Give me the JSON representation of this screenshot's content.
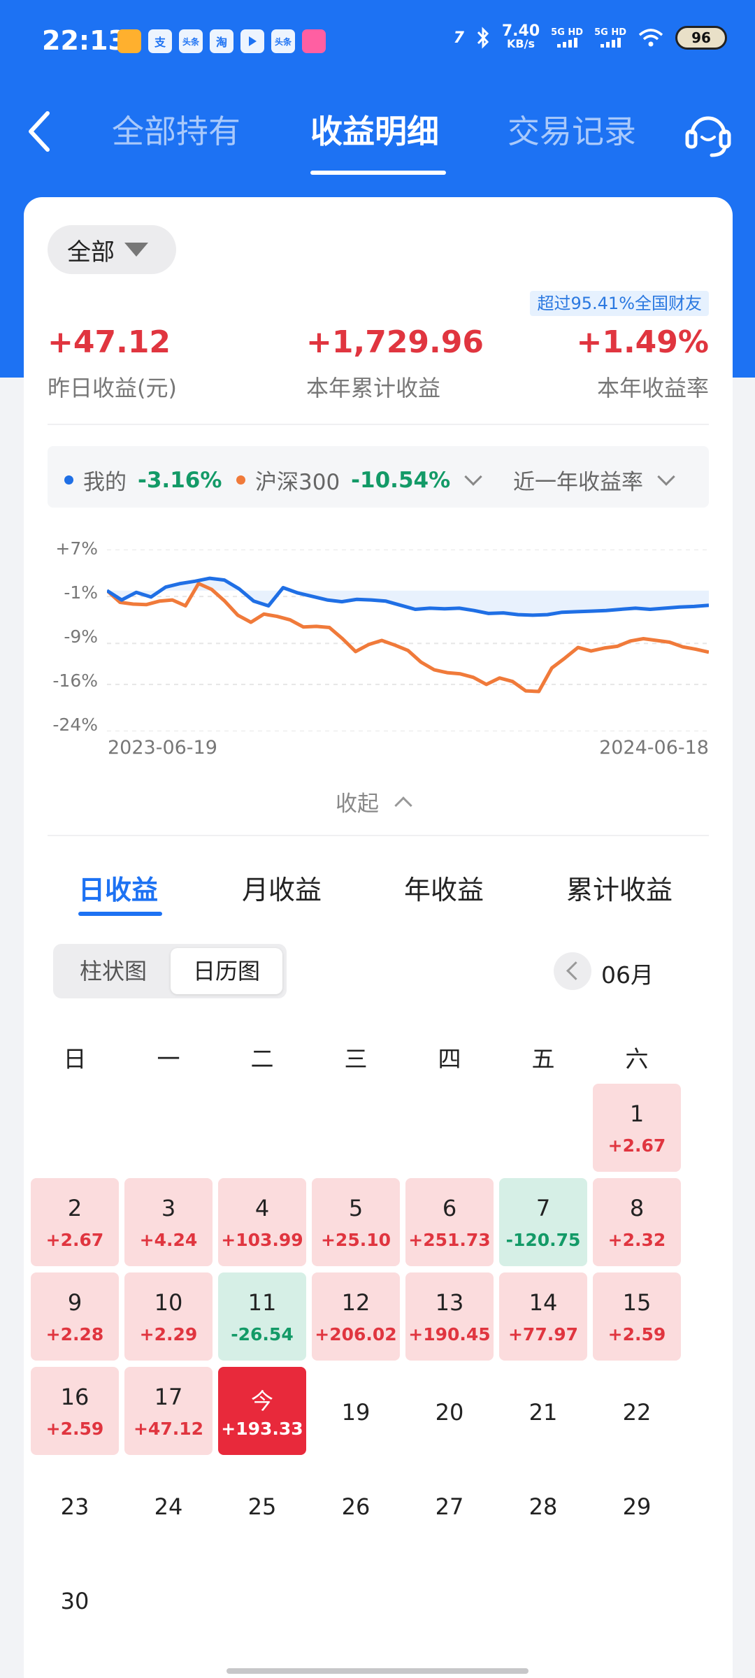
{
  "status_bar": {
    "time": "22:13",
    "apps": [
      {
        "icon": "video-app-icon",
        "label": ""
      },
      {
        "icon": "alipay-icon",
        "label": "支"
      },
      {
        "icon": "toutiao-icon",
        "label": "头条"
      },
      {
        "icon": "taobao-icon",
        "label": "淘"
      },
      {
        "icon": "play-app-icon",
        "label": ""
      },
      {
        "icon": "toutiao-icon",
        "label": "头条"
      },
      {
        "icon": "bilibili-icon",
        "label": ""
      }
    ],
    "carrier_tag": "7",
    "net_speed_value": "7.40",
    "net_speed_unit": "KB/s",
    "signal_1": "5G HD",
    "signal_2": "5G HD",
    "battery": "96"
  },
  "nav": {
    "tabs": [
      "全部持有",
      "收益明细",
      "交易记录"
    ],
    "active_tab": "收益明细"
  },
  "filter": {
    "label": "全部"
  },
  "rank_badge": "超过95.41%全国财友",
  "stats": [
    {
      "value": "+47.12",
      "label": "昨日收益(元)"
    },
    {
      "value": "+1,729.96",
      "label": "本年累计收益"
    },
    {
      "value": "+1.49%",
      "label": "本年收益率"
    }
  ],
  "compare": {
    "mine_label": "我的",
    "mine_value": "-3.16%",
    "index_label": "沪深300",
    "index_value": "-10.54%",
    "period": "近一年收益率"
  },
  "chart_data": {
    "type": "line",
    "yticks": [
      "+7%",
      "-1%",
      "-9%",
      "-16%",
      "-24%"
    ],
    "ylim": [
      -24,
      7
    ],
    "x_start": "2023-06-19",
    "x_end": "2024-06-18",
    "colors": {
      "mine": "#1f6fe5",
      "index": "#f07a3a"
    },
    "series": [
      {
        "name": "我的",
        "values": [
          0,
          -1.6,
          -0.3,
          -1.1,
          0.6,
          1.2,
          1.6,
          2.1,
          1.8,
          0.3,
          -1.8,
          -2.6,
          0.5,
          -0.4,
          -1.0,
          -1.6,
          -1.9,
          -1.5,
          -1.6,
          -1.8,
          -2.5,
          -3.2,
          -3.0,
          -3.1,
          -3.0,
          -3.4,
          -3.9,
          -3.8,
          -4.1,
          -4.2,
          -4.1,
          -3.7,
          -3.6,
          -3.5,
          -3.4,
          -3.2,
          -3.0,
          -3.2,
          -3.0,
          -2.8,
          -2.7,
          -2.5
        ]
      },
      {
        "name": "沪深300",
        "values": [
          0,
          -2.0,
          -2.3,
          -2.4,
          -1.8,
          -1.6,
          -2.6,
          1.2,
          0.2,
          -1.8,
          -4.2,
          -5.4,
          -4.0,
          -4.4,
          -5.0,
          -6.2,
          -6.1,
          -6.3,
          -8.2,
          -10.4,
          -9.2,
          -8.5,
          -9.3,
          -10.2,
          -12.2,
          -13.5,
          -14.0,
          -14.2,
          -14.8,
          -16.0,
          -14.9,
          -15.5,
          -17.1,
          -17.2,
          -13.2,
          -11.5,
          -9.7,
          -10.3,
          -9.8,
          -9.5,
          -8.6,
          -8.2,
          -8.5,
          -8.8,
          -9.6,
          -10.0,
          -10.5
        ]
      }
    ]
  },
  "collapse_label": "收起",
  "period_tabs": [
    "日收益",
    "月收益",
    "年收益",
    "累计收益"
  ],
  "active_period_tab": "日收益",
  "view_toggle": [
    "柱状图",
    "日历图"
  ],
  "active_view": "日历图",
  "month_label": "06月",
  "weekdays": [
    "日",
    "一",
    "二",
    "三",
    "四",
    "五",
    "六"
  ],
  "calendar": [
    {
      "label": "1",
      "value": "+2.67",
      "type": "gain"
    },
    {
      "label": "2",
      "value": "+2.67",
      "type": "gain"
    },
    {
      "label": "3",
      "value": "+4.24",
      "type": "gain"
    },
    {
      "label": "4",
      "value": "+103.99",
      "type": "gain"
    },
    {
      "label": "5",
      "value": "+25.10",
      "type": "gain"
    },
    {
      "label": "6",
      "value": "+251.73",
      "type": "gain"
    },
    {
      "label": "7",
      "value": "-120.75",
      "type": "loss"
    },
    {
      "label": "8",
      "value": "+2.32",
      "type": "gain"
    },
    {
      "label": "9",
      "value": "+2.28",
      "type": "gain"
    },
    {
      "label": "10",
      "value": "+2.29",
      "type": "gain"
    },
    {
      "label": "11",
      "value": "-26.54",
      "type": "loss"
    },
    {
      "label": "12",
      "value": "+206.02",
      "type": "gain"
    },
    {
      "label": "13",
      "value": "+190.45",
      "type": "gain"
    },
    {
      "label": "14",
      "value": "+77.97",
      "type": "gain"
    },
    {
      "label": "15",
      "value": "+2.59",
      "type": "gain"
    },
    {
      "label": "16",
      "value": "+2.59",
      "type": "gain"
    },
    {
      "label": "17",
      "value": "+47.12",
      "type": "gain"
    },
    {
      "label": "今",
      "value": "+193.33",
      "type": "today"
    },
    {
      "label": "19",
      "value": "",
      "type": "none"
    },
    {
      "label": "20",
      "value": "",
      "type": "none"
    },
    {
      "label": "21",
      "value": "",
      "type": "none"
    },
    {
      "label": "22",
      "value": "",
      "type": "none"
    },
    {
      "label": "23",
      "value": "",
      "type": "none"
    },
    {
      "label": "24",
      "value": "",
      "type": "none"
    },
    {
      "label": "25",
      "value": "",
      "type": "none"
    },
    {
      "label": "26",
      "value": "",
      "type": "none"
    },
    {
      "label": "27",
      "value": "",
      "type": "none"
    },
    {
      "label": "28",
      "value": "",
      "type": "none"
    },
    {
      "label": "29",
      "value": "",
      "type": "none"
    },
    {
      "label": "30",
      "value": "",
      "type": "none"
    }
  ],
  "calendar_first_weekday": 6,
  "colors": {
    "accent": "#1d72f3",
    "gain": "#e0353f",
    "loss": "#139a67",
    "today": "#e8293b"
  }
}
